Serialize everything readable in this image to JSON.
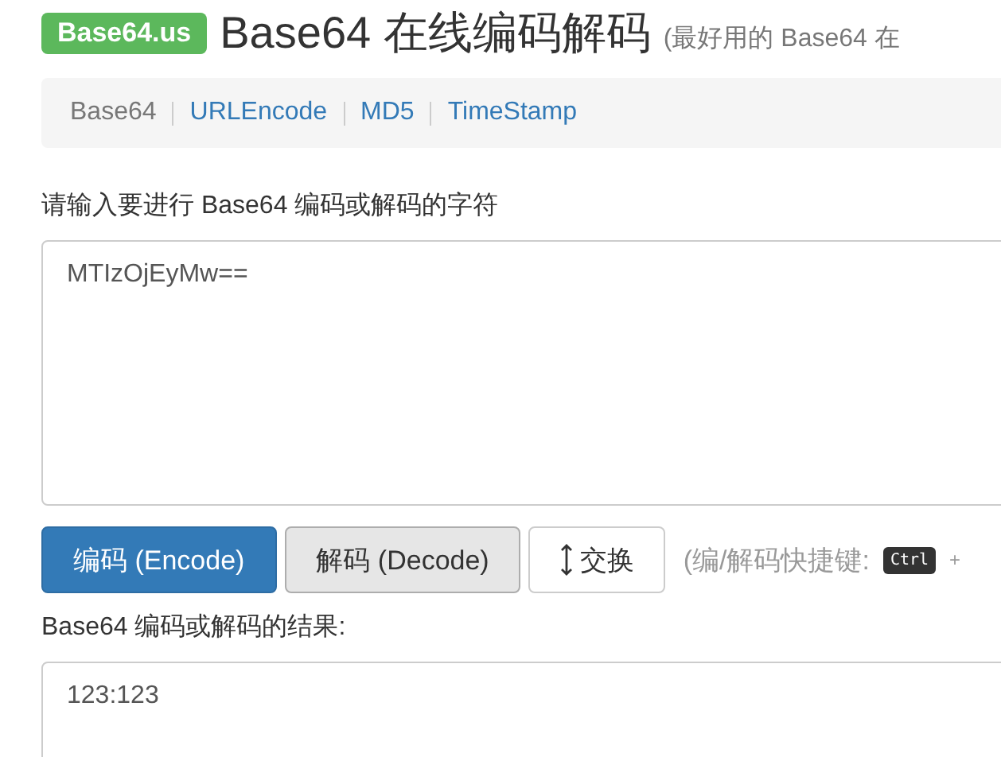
{
  "header": {
    "badge": "Base64.us",
    "title": "Base64 在线编码解码",
    "subtitle": "(最好用的 Base64 在"
  },
  "nav": [
    {
      "label": "Base64",
      "selected": true
    },
    {
      "label": "URLEncode",
      "selected": false
    },
    {
      "label": "MD5",
      "selected": false
    },
    {
      "label": "TimeStamp",
      "selected": false
    }
  ],
  "input": {
    "label": "请输入要进行 Base64 编码或解码的字符",
    "value": "MTIzOjEyMw=="
  },
  "buttons": [
    {
      "kind": "primary",
      "label": "编码 (Encode)"
    },
    {
      "kind": "pressed",
      "label": "解码 (Decode)"
    },
    {
      "kind": "swap",
      "label": "交换"
    }
  ],
  "hint": {
    "text": "(编/解码快捷键:",
    "key": "Ctrl",
    "plus": "+"
  },
  "output": {
    "label": "Base64 编码或解码的结果:",
    "value": "123:123"
  }
}
